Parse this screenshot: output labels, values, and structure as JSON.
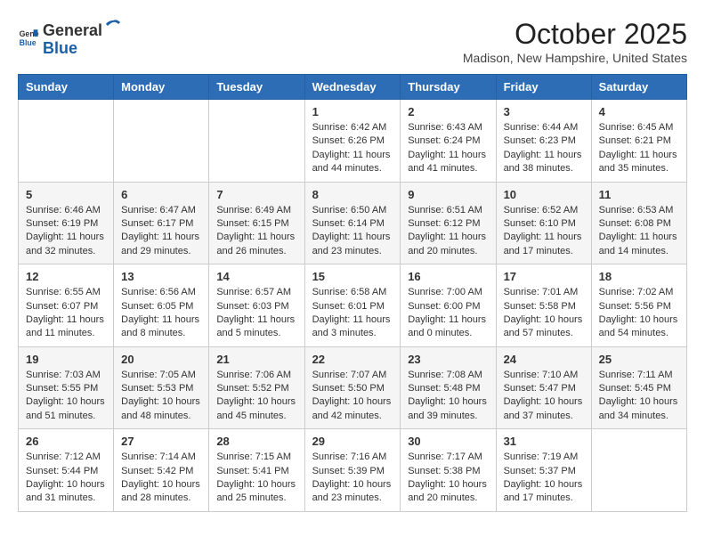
{
  "header": {
    "logo_general": "General",
    "logo_blue": "Blue",
    "month": "October 2025",
    "location": "Madison, New Hampshire, United States"
  },
  "days_of_week": [
    "Sunday",
    "Monday",
    "Tuesday",
    "Wednesday",
    "Thursday",
    "Friday",
    "Saturday"
  ],
  "weeks": [
    [
      {
        "day": "",
        "info": ""
      },
      {
        "day": "",
        "info": ""
      },
      {
        "day": "",
        "info": ""
      },
      {
        "day": "1",
        "info": "Sunrise: 6:42 AM\nSunset: 6:26 PM\nDaylight: 11 hours and 44 minutes."
      },
      {
        "day": "2",
        "info": "Sunrise: 6:43 AM\nSunset: 6:24 PM\nDaylight: 11 hours and 41 minutes."
      },
      {
        "day": "3",
        "info": "Sunrise: 6:44 AM\nSunset: 6:23 PM\nDaylight: 11 hours and 38 minutes."
      },
      {
        "day": "4",
        "info": "Sunrise: 6:45 AM\nSunset: 6:21 PM\nDaylight: 11 hours and 35 minutes."
      }
    ],
    [
      {
        "day": "5",
        "info": "Sunrise: 6:46 AM\nSunset: 6:19 PM\nDaylight: 11 hours and 32 minutes."
      },
      {
        "day": "6",
        "info": "Sunrise: 6:47 AM\nSunset: 6:17 PM\nDaylight: 11 hours and 29 minutes."
      },
      {
        "day": "7",
        "info": "Sunrise: 6:49 AM\nSunset: 6:15 PM\nDaylight: 11 hours and 26 minutes."
      },
      {
        "day": "8",
        "info": "Sunrise: 6:50 AM\nSunset: 6:14 PM\nDaylight: 11 hours and 23 minutes."
      },
      {
        "day": "9",
        "info": "Sunrise: 6:51 AM\nSunset: 6:12 PM\nDaylight: 11 hours and 20 minutes."
      },
      {
        "day": "10",
        "info": "Sunrise: 6:52 AM\nSunset: 6:10 PM\nDaylight: 11 hours and 17 minutes."
      },
      {
        "day": "11",
        "info": "Sunrise: 6:53 AM\nSunset: 6:08 PM\nDaylight: 11 hours and 14 minutes."
      }
    ],
    [
      {
        "day": "12",
        "info": "Sunrise: 6:55 AM\nSunset: 6:07 PM\nDaylight: 11 hours and 11 minutes."
      },
      {
        "day": "13",
        "info": "Sunrise: 6:56 AM\nSunset: 6:05 PM\nDaylight: 11 hours and 8 minutes."
      },
      {
        "day": "14",
        "info": "Sunrise: 6:57 AM\nSunset: 6:03 PM\nDaylight: 11 hours and 5 minutes."
      },
      {
        "day": "15",
        "info": "Sunrise: 6:58 AM\nSunset: 6:01 PM\nDaylight: 11 hours and 3 minutes."
      },
      {
        "day": "16",
        "info": "Sunrise: 7:00 AM\nSunset: 6:00 PM\nDaylight: 11 hours and 0 minutes."
      },
      {
        "day": "17",
        "info": "Sunrise: 7:01 AM\nSunset: 5:58 PM\nDaylight: 10 hours and 57 minutes."
      },
      {
        "day": "18",
        "info": "Sunrise: 7:02 AM\nSunset: 5:56 PM\nDaylight: 10 hours and 54 minutes."
      }
    ],
    [
      {
        "day": "19",
        "info": "Sunrise: 7:03 AM\nSunset: 5:55 PM\nDaylight: 10 hours and 51 minutes."
      },
      {
        "day": "20",
        "info": "Sunrise: 7:05 AM\nSunset: 5:53 PM\nDaylight: 10 hours and 48 minutes."
      },
      {
        "day": "21",
        "info": "Sunrise: 7:06 AM\nSunset: 5:52 PM\nDaylight: 10 hours and 45 minutes."
      },
      {
        "day": "22",
        "info": "Sunrise: 7:07 AM\nSunset: 5:50 PM\nDaylight: 10 hours and 42 minutes."
      },
      {
        "day": "23",
        "info": "Sunrise: 7:08 AM\nSunset: 5:48 PM\nDaylight: 10 hours and 39 minutes."
      },
      {
        "day": "24",
        "info": "Sunrise: 7:10 AM\nSunset: 5:47 PM\nDaylight: 10 hours and 37 minutes."
      },
      {
        "day": "25",
        "info": "Sunrise: 7:11 AM\nSunset: 5:45 PM\nDaylight: 10 hours and 34 minutes."
      }
    ],
    [
      {
        "day": "26",
        "info": "Sunrise: 7:12 AM\nSunset: 5:44 PM\nDaylight: 10 hours and 31 minutes."
      },
      {
        "day": "27",
        "info": "Sunrise: 7:14 AM\nSunset: 5:42 PM\nDaylight: 10 hours and 28 minutes."
      },
      {
        "day": "28",
        "info": "Sunrise: 7:15 AM\nSunset: 5:41 PM\nDaylight: 10 hours and 25 minutes."
      },
      {
        "day": "29",
        "info": "Sunrise: 7:16 AM\nSunset: 5:39 PM\nDaylight: 10 hours and 23 minutes."
      },
      {
        "day": "30",
        "info": "Sunrise: 7:17 AM\nSunset: 5:38 PM\nDaylight: 10 hours and 20 minutes."
      },
      {
        "day": "31",
        "info": "Sunrise: 7:19 AM\nSunset: 5:37 PM\nDaylight: 10 hours and 17 minutes."
      },
      {
        "day": "",
        "info": ""
      }
    ]
  ]
}
